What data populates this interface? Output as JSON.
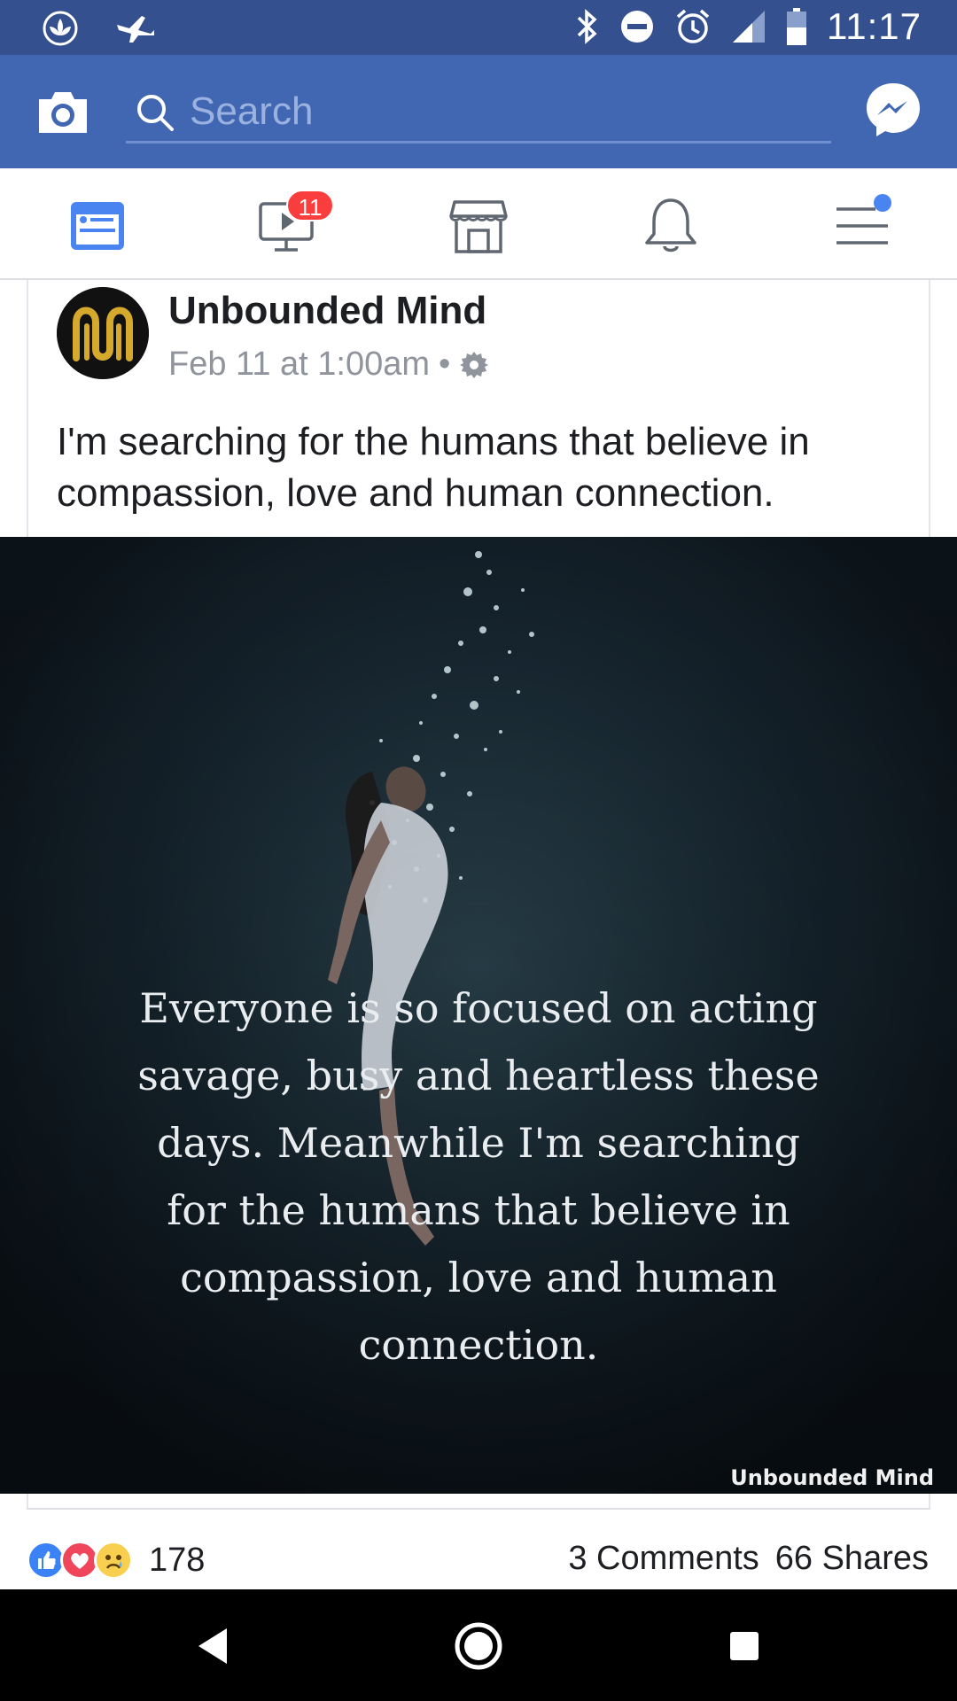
{
  "status_bar": {
    "time": "11:17",
    "icons": [
      "lotus-icon",
      "plane-icon",
      "bluetooth-icon",
      "do-not-disturb-icon",
      "alarm-icon",
      "signal-icon",
      "battery-icon"
    ]
  },
  "header": {
    "search_placeholder": "Search",
    "icons": [
      "camera-icon",
      "search-icon",
      "messenger-icon"
    ]
  },
  "tabs": {
    "items": [
      "news-feed-tab",
      "watch-tab",
      "marketplace-tab",
      "notifications-tab",
      "menu-tab"
    ],
    "watch_badge": "11"
  },
  "post": {
    "author": "Unbounded Mind",
    "timestamp": "Feb 11 at 1:00am",
    "meta_separator": "•",
    "text": "I'm searching for the humans that believe in compassion, love and human connection.",
    "image": {
      "quote": "Everyone is so focused on acting savage, busy and heartless these days. Meanwhile I'm searching for the humans that believe in compassion, love and human connection.",
      "watermark": "Unbounded Mind"
    },
    "reactions": {
      "types": [
        "like",
        "love",
        "sad"
      ],
      "count": "178"
    },
    "comments": "3 Comments",
    "shares": "66 Shares"
  },
  "colors": {
    "status_bar": "#35508f",
    "header": "#4267b2",
    "accent": "#4a84f0",
    "badge": "#fa3e3e"
  }
}
